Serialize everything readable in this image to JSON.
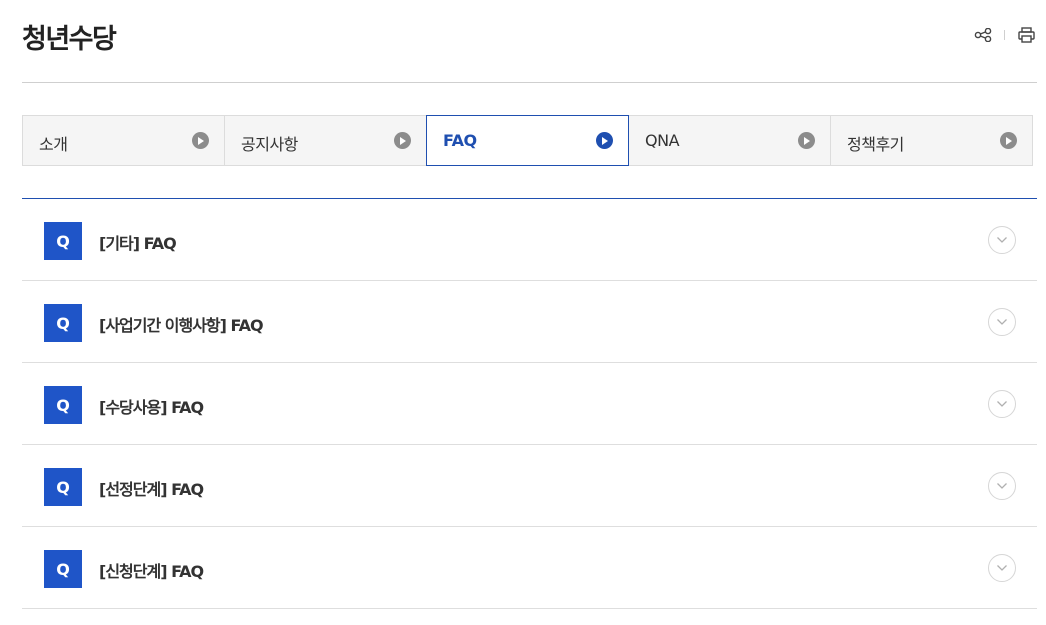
{
  "page": {
    "title": "청년수당"
  },
  "header_tools": {
    "share_icon": "share-icon",
    "print_icon": "print-icon"
  },
  "colors": {
    "accent": "#1f4fb0",
    "badge": "#1f55c8",
    "inactive_arrow": "#8c8c8c"
  },
  "tabs": [
    {
      "label": "소개",
      "active": false
    },
    {
      "label": "공지사항",
      "active": false
    },
    {
      "label": "FAQ",
      "active": true
    },
    {
      "label": "QNA",
      "active": false
    },
    {
      "label": "정책후기",
      "active": false
    }
  ],
  "faq": {
    "badge": "Q",
    "items": [
      {
        "title": "[기타] FAQ"
      },
      {
        "title": "[사업기간 이행사항] FAQ"
      },
      {
        "title": "[수당사용] FAQ"
      },
      {
        "title": "[선정단계] FAQ"
      },
      {
        "title": "[신청단계] FAQ"
      }
    ]
  }
}
